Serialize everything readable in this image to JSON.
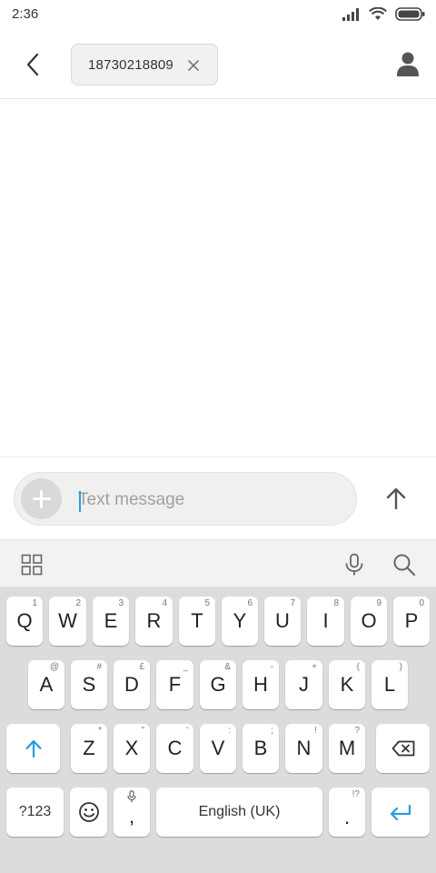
{
  "status_bar": {
    "time": "2:36",
    "icons": [
      "signal-icon",
      "wifi-icon",
      "battery-icon"
    ]
  },
  "header": {
    "back_icon": "back-arrow-icon",
    "recipient": "18730218809",
    "chip_close_icon": "close-icon",
    "contact_icon": "contact-person-icon"
  },
  "compose": {
    "add_icon": "plus-icon",
    "placeholder": "Text message",
    "value": "",
    "send_icon": "send-arrow-icon"
  },
  "keyboard_toolbar": {
    "icons": [
      "grid-icon",
      "microphone-icon",
      "search-icon"
    ]
  },
  "keyboard": {
    "row1": [
      {
        "key": "Q",
        "hint": "1"
      },
      {
        "key": "W",
        "hint": "2"
      },
      {
        "key": "E",
        "hint": "3"
      },
      {
        "key": "R",
        "hint": "4"
      },
      {
        "key": "T",
        "hint": "5"
      },
      {
        "key": "Y",
        "hint": "6"
      },
      {
        "key": "U",
        "hint": "7"
      },
      {
        "key": "I",
        "hint": "8"
      },
      {
        "key": "O",
        "hint": "9"
      },
      {
        "key": "P",
        "hint": "0"
      }
    ],
    "row2": [
      {
        "key": "A",
        "hint": "@"
      },
      {
        "key": "S",
        "hint": "#"
      },
      {
        "key": "D",
        "hint": "£"
      },
      {
        "key": "F",
        "hint": "_"
      },
      {
        "key": "G",
        "hint": "&"
      },
      {
        "key": "H",
        "hint": "-"
      },
      {
        "key": "J",
        "hint": "+"
      },
      {
        "key": "K",
        "hint": "("
      },
      {
        "key": "L",
        "hint": ")"
      }
    ],
    "row3": [
      {
        "key": "Z",
        "hint": "*"
      },
      {
        "key": "X",
        "hint": "\""
      },
      {
        "key": "C",
        "hint": "'"
      },
      {
        "key": "V",
        "hint": ":"
      },
      {
        "key": "B",
        "hint": ";"
      },
      {
        "key": "N",
        "hint": "!"
      },
      {
        "key": "M",
        "hint": "?"
      }
    ],
    "shift_icon": "shift-arrow-icon",
    "backspace_icon": "backspace-icon",
    "symbols_label": "?123",
    "emoji_icon": "emoji-icon",
    "comma_label": ",",
    "comma_hint_icon": "microphone-icon",
    "space_label": "English (UK)",
    "period_label": ".",
    "period_hint": "!?",
    "enter_icon": "enter-arrow-icon",
    "accent_color": "#2a9be0"
  }
}
